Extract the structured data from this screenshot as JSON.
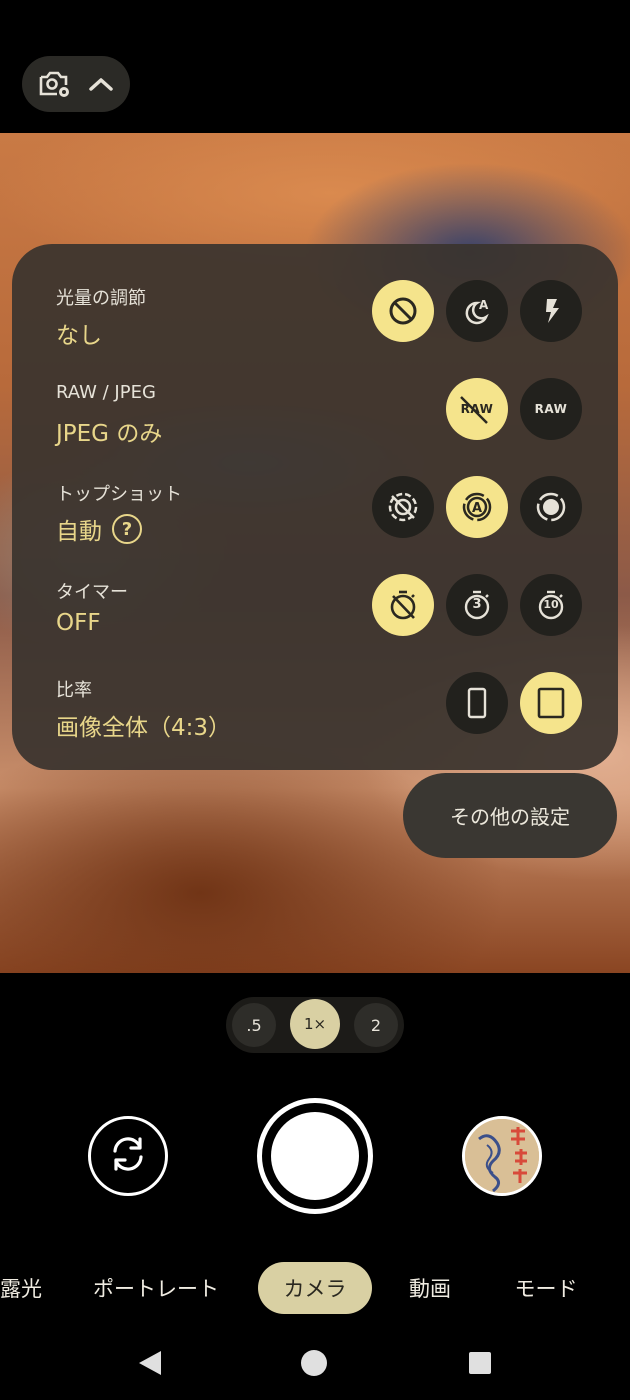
{
  "top_bar": {
    "settings_icon": "camera-settings-icon",
    "expand_icon": "chevron-up-icon"
  },
  "settings_panel": {
    "rows": [
      {
        "label": "光量の調節",
        "value": "なし",
        "options": [
          {
            "icon": "off-icon",
            "active": true
          },
          {
            "icon": "night-auto-icon",
            "active": false
          },
          {
            "icon": "flash-icon",
            "active": false
          }
        ]
      },
      {
        "label": "RAW / JPEG",
        "value": "JPEG のみ",
        "options": [
          {
            "icon": "raw-off-icon",
            "text": "RAW",
            "active": true
          },
          {
            "icon": "raw-icon",
            "text": "RAW",
            "active": false
          }
        ]
      },
      {
        "label": "トップショット",
        "value": "自動",
        "help": "?",
        "options": [
          {
            "icon": "top-shot-off-icon",
            "active": false
          },
          {
            "icon": "top-shot-auto-icon",
            "active": true
          },
          {
            "icon": "top-shot-on-icon",
            "active": false
          }
        ]
      },
      {
        "label": "タイマー",
        "value": "OFF",
        "options": [
          {
            "icon": "timer-off-icon",
            "active": true
          },
          {
            "icon": "timer-3-icon",
            "text": "3",
            "active": false
          },
          {
            "icon": "timer-10-icon",
            "text": "10",
            "active": false
          }
        ]
      },
      {
        "label": "比率",
        "value": "画像全体（4:3）",
        "options": [
          {
            "icon": "ratio-full-icon",
            "active": false
          },
          {
            "icon": "ratio-4-3-icon",
            "active": true
          }
        ]
      }
    ]
  },
  "more_settings_label": "その他の設定",
  "zoom": [
    {
      "label": ".5",
      "active": false
    },
    {
      "label": "1×",
      "active": true
    },
    {
      "label": "2",
      "active": false
    }
  ],
  "controls": {
    "switch_icon": "switch-camera-icon",
    "shutter": "shutter-button",
    "thumbnail": "last-photo-thumbnail"
  },
  "modes": [
    {
      "label": "露光",
      "active": false
    },
    {
      "label": "ポートレート",
      "active": false
    },
    {
      "label": "カメラ",
      "active": true
    },
    {
      "label": "動画",
      "active": false
    },
    {
      "label": "モード",
      "active": false
    }
  ],
  "colors": {
    "accent": "#f5e48c",
    "accent_text": "#e8d68a",
    "panel": "#3a342e",
    "mode_active": "#d9d0a3"
  }
}
